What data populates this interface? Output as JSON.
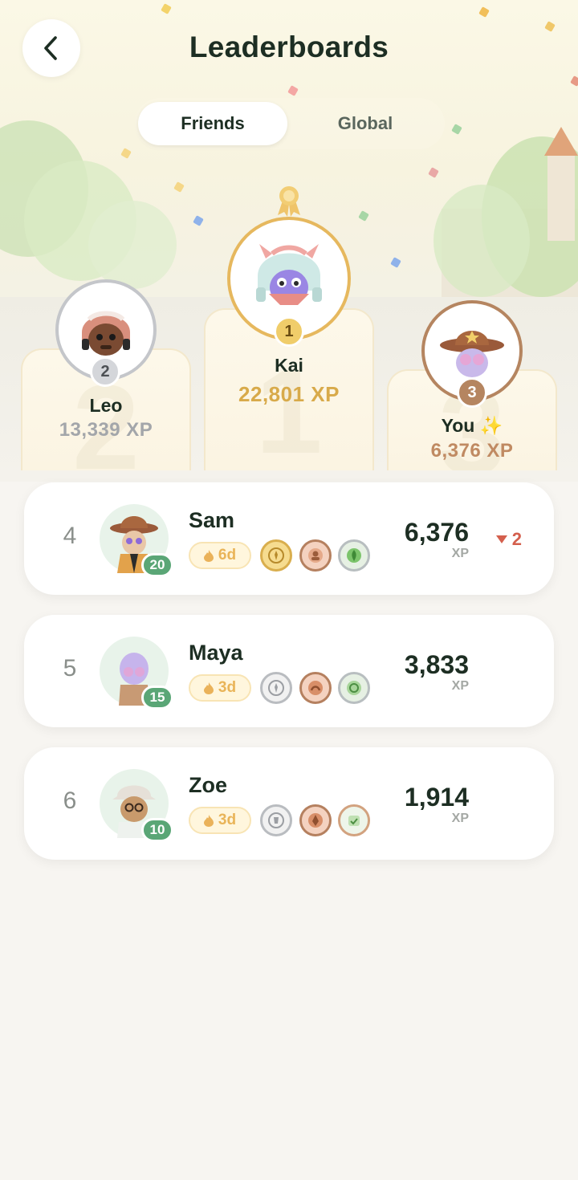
{
  "header": {
    "title": "Leaderboards",
    "back_icon": "chevron-left-icon"
  },
  "tabs": [
    {
      "label": "Friends",
      "selected": true
    },
    {
      "label": "Global",
      "selected": false
    }
  ],
  "podium": {
    "first": {
      "rank": "1",
      "name": "Kai",
      "xp": "22,801 XP",
      "ring_color": "#e6b85e"
    },
    "second": {
      "rank": "2",
      "name": "Leo",
      "xp": "13,339 XP",
      "ring_color": "#c4c6ca"
    },
    "third": {
      "rank": "3",
      "name": "You ✨",
      "xp": "6,376 XP",
      "ring_color": "#b58560"
    }
  },
  "list": [
    {
      "rank": "4",
      "name": "Sam",
      "level": "20",
      "streak": "6d",
      "xp": "6,376",
      "xp_unit": "XP",
      "change": "2",
      "change_direction": "down",
      "medals": [
        "gold-medal-icon",
        "bronze-medal-icon",
        "green-medal-icon"
      ]
    },
    {
      "rank": "5",
      "name": "Maya",
      "level": "15",
      "streak": "3d",
      "xp": "3,833",
      "xp_unit": "XP",
      "medals": [
        "silver-medal-icon",
        "bronze-medal-icon",
        "green-medal-icon"
      ]
    },
    {
      "rank": "6",
      "name": "Zoe",
      "level": "10",
      "streak": "3d",
      "xp": "1,914",
      "xp_unit": "XP",
      "medals": [
        "silver-medal-icon",
        "bronze-medal-icon",
        "green-medal-icon"
      ]
    }
  ],
  "colors": {
    "gold": "#d8aa4a",
    "silver": "#a3a6aa",
    "bronze": "#b58560",
    "level_green": "#5aa676",
    "rank_down": "#d45f4d"
  }
}
